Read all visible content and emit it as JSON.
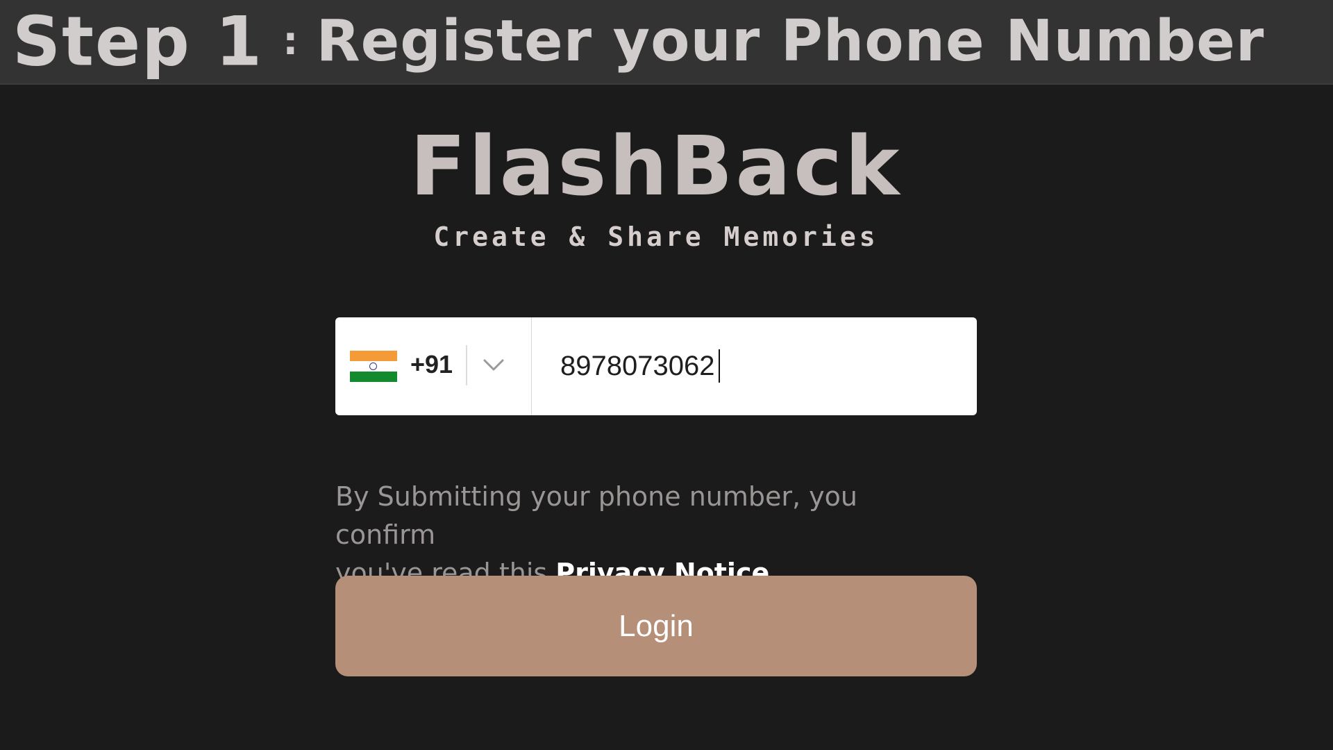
{
  "banner": {
    "step": "Step 1",
    "separator": ":",
    "subtitle": "Register your Phone Number"
  },
  "app": {
    "logo": "FlashBack",
    "tagline": "Create & Share Memories"
  },
  "phone_form": {
    "flag_icon": "india-flag-icon",
    "country_code": "+91",
    "dropdown_icon": "chevron-down-icon",
    "phone_value": "8978073062"
  },
  "notice": {
    "text_line1": "By Submitting your phone number, you confirm",
    "text_line2": "you've read this ",
    "link_label": "Privacy Notice"
  },
  "login": {
    "label": "Login"
  },
  "colors": {
    "background": "#1b1b1b",
    "banner_background": "#333333",
    "accent_button": "#b68f79",
    "flag_saffron": "#f49a36",
    "flag_green": "#138a2e"
  }
}
